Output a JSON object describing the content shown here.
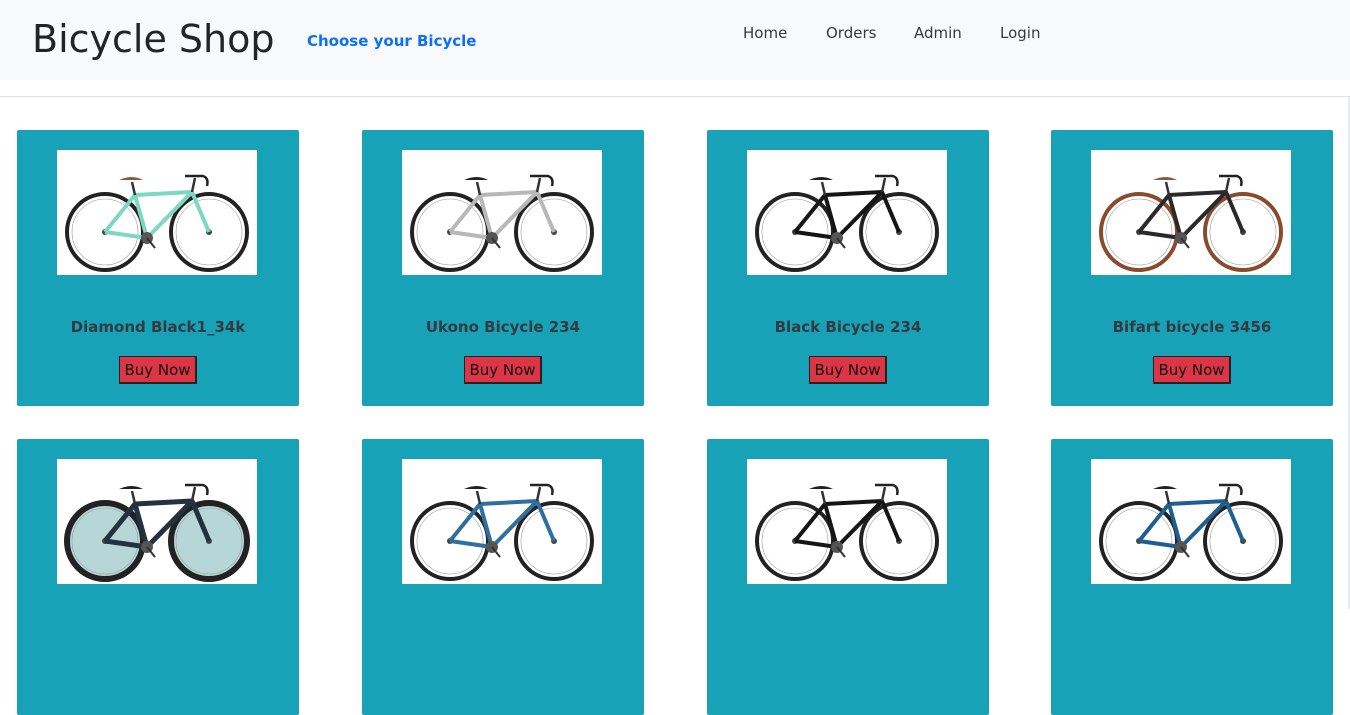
{
  "header": {
    "brand": "Bicycle Shop",
    "tagline": "Choose your Bicycle",
    "nav": [
      "Home",
      "Orders",
      "Admin",
      "Login"
    ]
  },
  "products": [
    {
      "name": "Diamond Black1_34k",
      "button": "Buy Now",
      "frame_color": "#7dd8c0"
    },
    {
      "name": "Ukono Bicycle 234",
      "button": "Buy Now",
      "frame_color": "#b8b8b8"
    },
    {
      "name": "Black Bicycle 234",
      "button": "Buy Now",
      "frame_color": "#151515"
    },
    {
      "name": "Bifart bicycle 3456",
      "button": "Buy Now",
      "frame_color": "#2a2a2a"
    },
    {
      "name": "",
      "button": "",
      "frame_color": "#22323f"
    },
    {
      "name": "",
      "button": "",
      "frame_color": "#2f6f9e"
    },
    {
      "name": "",
      "button": "",
      "frame_color": "#151515"
    },
    {
      "name": "",
      "button": "",
      "frame_color": "#1f5f8f"
    }
  ],
  "colors": {
    "card_bg": "#17a2b8",
    "button_bg": "#dc3545",
    "tagline": "#0d6efd",
    "navbar_bg": "#f8f9fa"
  }
}
